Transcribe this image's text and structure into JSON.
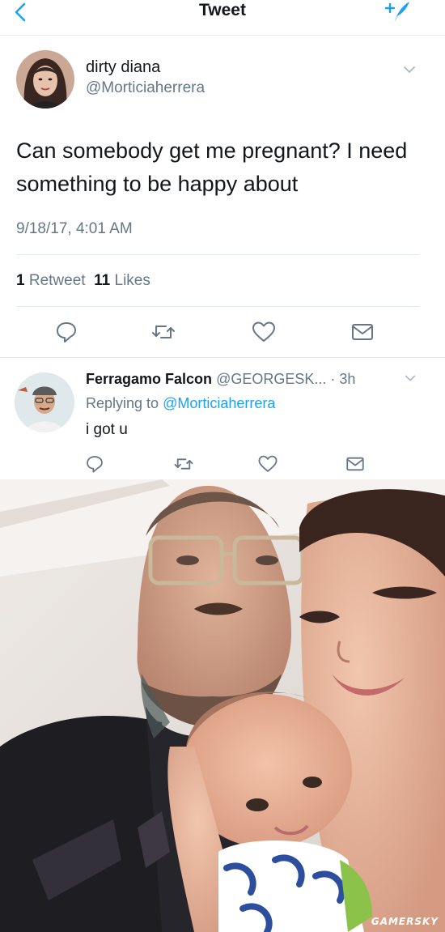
{
  "header": {
    "title": "Tweet",
    "back_icon": "chevron-left-icon",
    "compose_icon": "compose-tweet-icon",
    "accent": "#1da1f2"
  },
  "tweet": {
    "author_name": "dirty diana",
    "author_handle": "@Morticiaherrera",
    "text": "Can somebody get me pregnant? I need something to be happy about",
    "timestamp": "9/18/17, 4:01 AM",
    "retweet_count": "1",
    "retweet_label": "Retweet",
    "like_count": "11",
    "like_label": "Likes"
  },
  "reply": {
    "author_name": "Ferragamo Falcon",
    "author_handle": "@GEORGESK...",
    "time": "· 3h",
    "replying_label": "Replying to",
    "replying_to": "@Morticiaherrera",
    "text": "i got u"
  },
  "photo": {
    "watermark": "GAMERSKY"
  },
  "colors": {
    "text": "#14171a",
    "secondary": "#657786",
    "divider": "#e1e8ed",
    "link": "#1da1f2"
  }
}
